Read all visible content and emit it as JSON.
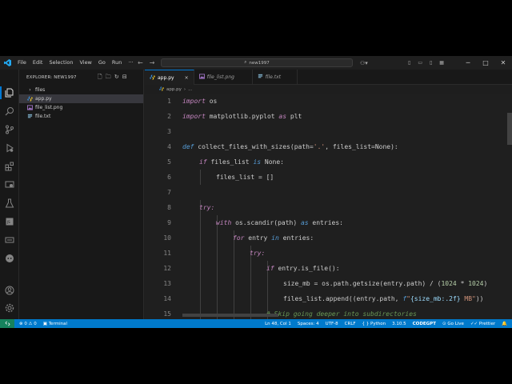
{
  "titlebar": {
    "menu": [
      "File",
      "Edit",
      "Selection",
      "View",
      "Go",
      "Run",
      "···"
    ],
    "search": "new1997"
  },
  "sidebar": {
    "header": "EXPLORER: NEW1997",
    "items": [
      {
        "label": "files",
        "type": "folder"
      },
      {
        "label": "app.py",
        "type": "python",
        "selected": true
      },
      {
        "label": "file_list.png",
        "type": "image"
      },
      {
        "label": "file.txt",
        "type": "text"
      }
    ]
  },
  "tabs": [
    {
      "label": "app.py",
      "active": true,
      "close": "×"
    },
    {
      "label": "file_list.png",
      "active": false
    },
    {
      "label": "file.txt",
      "active": false
    }
  ],
  "breadcrumb": {
    "file": "app.py",
    "more": "..."
  },
  "editor": {
    "lines": [
      {
        "n": "1"
      },
      {
        "n": "2"
      },
      {
        "n": "3"
      },
      {
        "n": "4"
      },
      {
        "n": "5"
      },
      {
        "n": "6"
      },
      {
        "n": "7"
      },
      {
        "n": "8"
      },
      {
        "n": "9"
      },
      {
        "n": "10"
      },
      {
        "n": "11"
      },
      {
        "n": "12"
      },
      {
        "n": "13"
      },
      {
        "n": "14"
      },
      {
        "n": "15"
      }
    ],
    "tokens": {
      "import": "import",
      "os": " os",
      "matplotlib": " matplotlib.pyplot ",
      "as": "as",
      "plt": " plt",
      "def": "def",
      "fname": " collect_files_with_sizes",
      "sig_a": "(path=",
      "sig_str": "'.'",
      "sig_b": ", files_list=None):",
      "if": "if",
      "if_rest": " files_list ",
      "is": "is",
      "none": " None:",
      "assign": "files_list = []",
      "try": "try:",
      "with": "with",
      "with_rest": " os.scandir(path) ",
      "entries": " entries:",
      "for": "for",
      "entry": " entry ",
      "in": "in",
      "in_rest": " entries:",
      "try2": "try:",
      "if2": "if",
      "isfile": " entry.is_file():",
      "size_a": "size_mb = os.path.getsize(entry.path) / (",
      "n1024a": "1024",
      "star": " * ",
      "n1024b": "1024",
      "paren": ")",
      "append_a": "files_list.append((entry.path, ",
      "fstr_f": "f",
      "fstr_a": "\"",
      "fstr_b": "{size_mb:.2f}",
      "fstr_c": " MB\"",
      "append_b": "))",
      "comment": "# Skip going deeper into subdirectories"
    }
  },
  "statusbar": {
    "errors": "0",
    "warnings": "0",
    "terminal": "Terminal",
    "position": "Ln 48, Col 1",
    "spaces": "Spaces: 4",
    "encoding": "UTF-8",
    "eol": "CRLF",
    "language": "Python",
    "version": "3.10.5",
    "codegpt": "CODEGPT",
    "golive": "Go Live",
    "prettier": "Prettier"
  }
}
